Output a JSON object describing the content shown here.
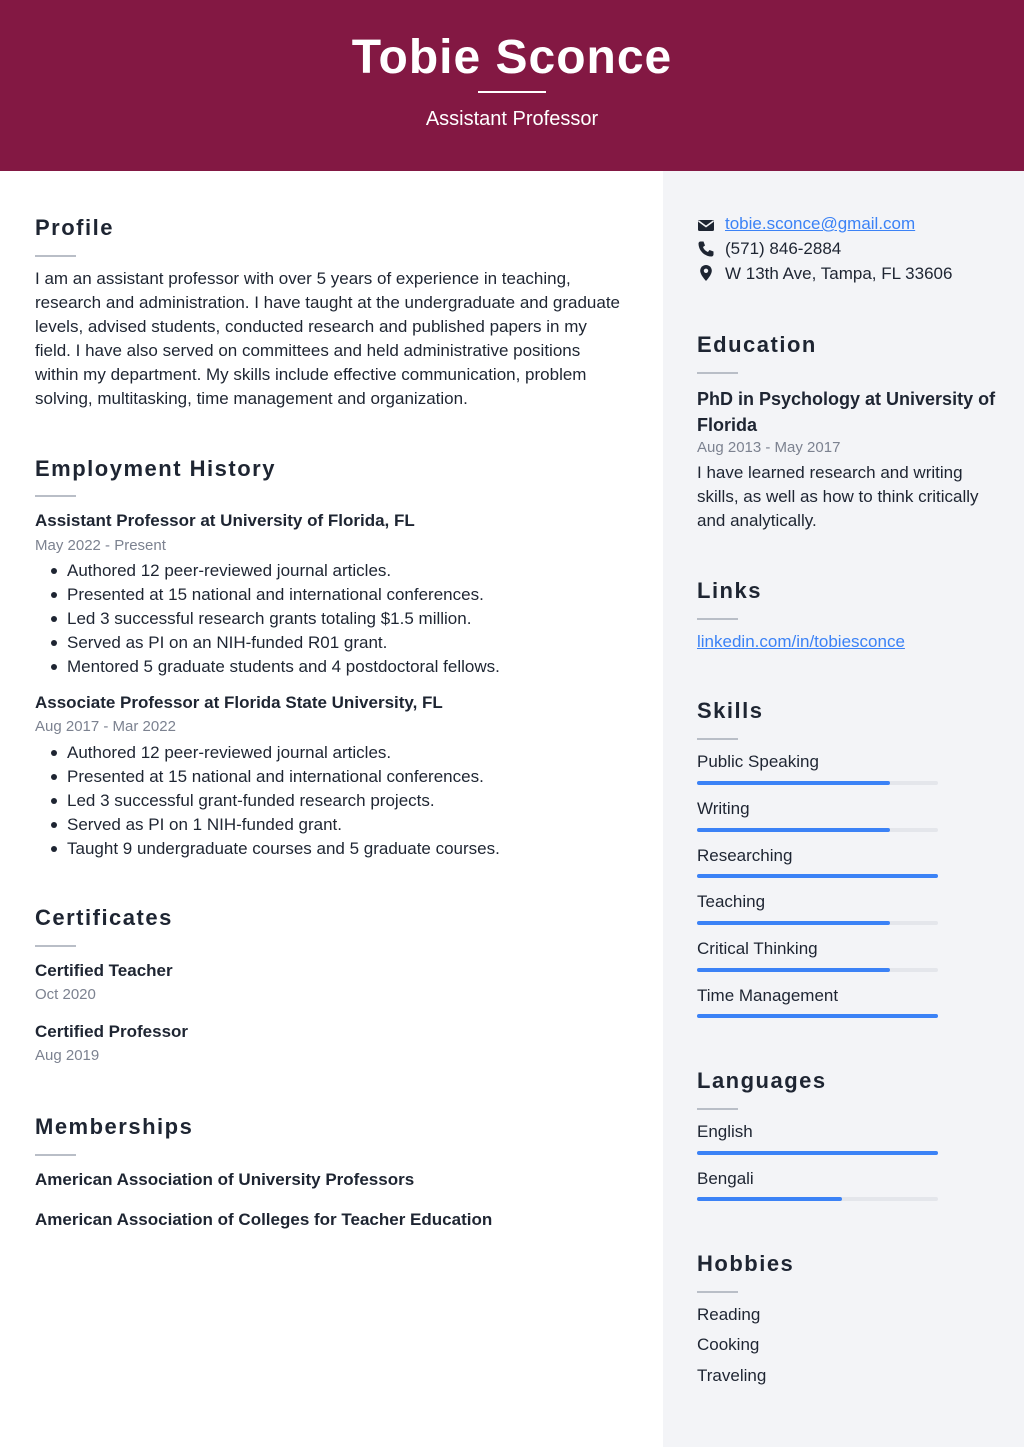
{
  "header": {
    "name": "Tobie Sconce",
    "job_title": "Assistant Professor",
    "background_color": "#831843"
  },
  "profile": {
    "title": "Profile",
    "lines": [
      "I am an assistant professor with over 5 years of experience in teaching,",
      "research and administration. I have taught at the undergraduate and graduate",
      "levels, advised students, conducted research and published papers in my",
      "field. I have also served on committees and held administrative positions",
      "within my department. My skills include effective communication, problem",
      "solving, multitasking, time management and organization."
    ]
  },
  "employment": {
    "title": "Employment History",
    "jobs": [
      {
        "role": "Assistant Professor at University of Florida, FL",
        "dates": "May 2022 - Present",
        "bullets": [
          "Authored 12 peer-reviewed journal articles.",
          "Presented at 15 national and international conferences.",
          "Led 3 successful research grants totaling $1.5 million.",
          "Served as PI on an NIH-funded R01 grant.",
          "Mentored 5 graduate students and 4 postdoctoral fellows."
        ]
      },
      {
        "role": "Associate Professor at Florida State University, FL",
        "dates": "Aug 2017 - Mar 2022",
        "bullets": [
          "Authored 12 peer-reviewed journal articles.",
          "Presented at 15 national and international conferences.",
          "Led 3 successful grant-funded research projects.",
          "Served as PI on 1 NIH-funded grant.",
          "Taught 9 undergraduate courses and 5 graduate courses."
        ]
      }
    ]
  },
  "certificates": {
    "title": "Certificates",
    "items": [
      {
        "name": "Certified Teacher",
        "date": "Oct 2020"
      },
      {
        "name": "Certified Professor",
        "date": "Aug 2019"
      }
    ]
  },
  "memberships": {
    "title": "Memberships",
    "items": [
      "American Association of University Professors",
      "American Association of Colleges for Teacher Education"
    ]
  },
  "contact": {
    "email": "tobie.sconce@gmail.com",
    "phone": "(571) 846-2884",
    "address": "W 13th Ave, Tampa, FL 33606",
    "icons": [
      "envelope-icon",
      "phone-icon",
      "map-pin-icon"
    ]
  },
  "education": {
    "title": "Education",
    "degree_line1": "PhD in Psychology at University of",
    "degree_line2": "Florida",
    "dates": "Aug 2013 - May 2017",
    "description": [
      "I have learned research and writing",
      "skills, as well as how to think critically",
      "and analytically."
    ]
  },
  "links": {
    "title": "Links",
    "items": [
      "linkedin.com/in/tobiesconce"
    ],
    "color": "#3b82f6"
  },
  "skills": {
    "title": "Skills",
    "bar_color": "#3b82f6",
    "items": [
      {
        "name": "Public Speaking",
        "level": 0.8
      },
      {
        "name": "Writing",
        "level": 0.8
      },
      {
        "name": "Researching",
        "level": 1.0
      },
      {
        "name": "Teaching",
        "level": 0.8
      },
      {
        "name": "Critical Thinking",
        "level": 0.8
      },
      {
        "name": "Time Management",
        "level": 1.0
      }
    ]
  },
  "languages": {
    "title": "Languages",
    "items": [
      {
        "name": "English",
        "level": 1.0
      },
      {
        "name": "Bengali",
        "level": 0.6
      }
    ]
  },
  "hobbies": {
    "title": "Hobbies",
    "items": [
      "Reading",
      "Cooking",
      "Traveling"
    ]
  }
}
